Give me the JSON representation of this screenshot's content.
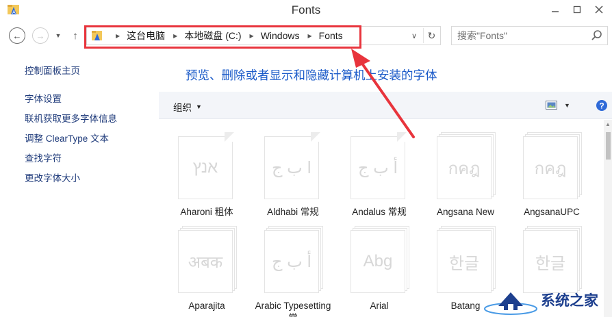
{
  "window": {
    "title": "Fonts"
  },
  "navigation": {
    "back_icon": "back-arrow-icon",
    "forward_icon": "forward-arrow-icon",
    "up_icon": "up-arrow-icon",
    "breadcrumbs": [
      "这台电脑",
      "本地磁盘 (C:)",
      "Windows",
      "Fonts"
    ],
    "search_placeholder": "搜索\"Fonts\""
  },
  "sidebar": {
    "home": "控制面板主页",
    "links": [
      "字体设置",
      "联机获取更多字体信息",
      "调整 ClearType 文本",
      "查找字符",
      "更改字体大小"
    ]
  },
  "main": {
    "heading": "预览、删除或者显示和隐藏计算机上安装的字体",
    "toolbar": {
      "organize": "组织"
    },
    "fonts": [
      {
        "name": "Aharoni 粗体",
        "sample": "אנץ"
      },
      {
        "name": "Aldhabi 常规",
        "sample": "ا ب ج"
      },
      {
        "name": "Andalus 常规",
        "sample": "أ ب ج"
      },
      {
        "name": "Angsana New",
        "sample": "กคฎ"
      },
      {
        "name": "AngsanaUPC",
        "sample": "กคฎ"
      },
      {
        "name": "Aparajita",
        "sample": "अबक"
      },
      {
        "name": "Arabic Typesetting 常",
        "sample": "أ ب ج"
      },
      {
        "name": "Arial",
        "sample": "Abg"
      },
      {
        "name": "Batang",
        "sample": "한글"
      },
      {
        "name": "",
        "sample": "한글"
      }
    ]
  },
  "watermark": {
    "text": "系统之家"
  },
  "colors": {
    "highlight": "#e8343c",
    "heading": "#1d5cc9",
    "link": "#1e3a7a"
  }
}
